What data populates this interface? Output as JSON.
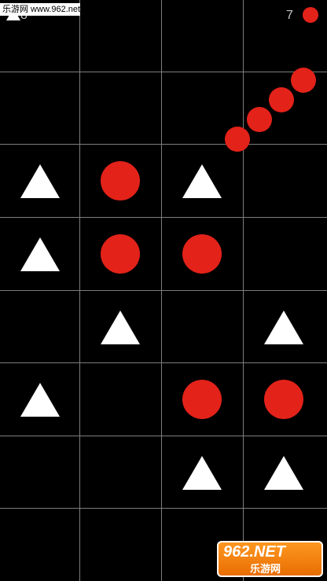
{
  "hud": {
    "left_score": "8",
    "right_score": "7",
    "left_icon": "white-triangle-icon",
    "right_icon": "red-circle-icon"
  },
  "watermark": {
    "top_text": "乐游网 www.962.net",
    "logo_text": "962.NET",
    "logo_subtext": "乐游网"
  },
  "colors": {
    "background": "#000000",
    "grid": "#7d7d7d",
    "triangle": "#ffffff",
    "circle": "#e32219"
  },
  "board": [
    [
      "",
      "",
      "",
      ""
    ],
    [
      "",
      "",
      "",
      ""
    ],
    [
      "triangle",
      "circle",
      "triangle",
      ""
    ],
    [
      "triangle",
      "circle",
      "circle",
      ""
    ],
    [
      "",
      "triangle",
      "",
      "triangle"
    ],
    [
      "triangle",
      "",
      "circle",
      "circle"
    ],
    [
      "",
      "",
      "triangle",
      "triangle"
    ],
    [
      "",
      "",
      "",
      ""
    ]
  ]
}
